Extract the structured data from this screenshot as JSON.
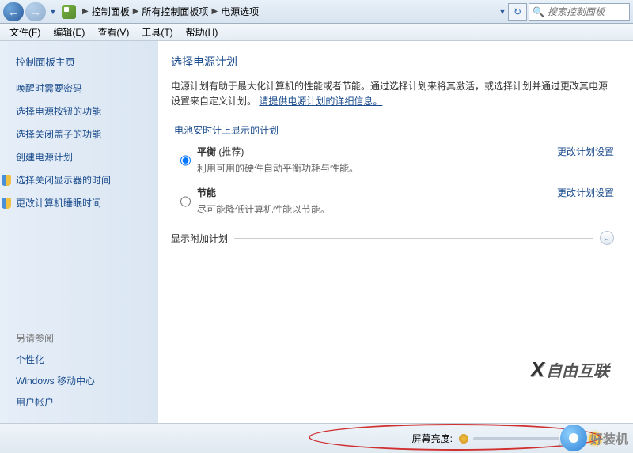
{
  "breadcrumb": {
    "root": "控制面板",
    "mid": "所有控制面板项",
    "leaf": "电源选项"
  },
  "search": {
    "placeholder": "搜索控制面板"
  },
  "menu": {
    "file": "文件(F)",
    "edit": "编辑(E)",
    "view": "查看(V)",
    "tools": "工具(T)",
    "help": "帮助(H)"
  },
  "sidebar": {
    "home": "控制面板主页",
    "links": [
      "唤醒时需要密码",
      "选择电源按钮的功能",
      "选择关闭盖子的功能",
      "创建电源计划",
      "选择关闭显示器的时间",
      "更改计算机睡眠时间"
    ],
    "see_also_title": "另请参阅",
    "see_also": [
      "个性化",
      "Windows 移动中心",
      "用户帐户"
    ]
  },
  "content": {
    "title": "选择电源计划",
    "desc_prefix": "电源计划有助于最大化计算机的性能或者节能。通过选择计划来将其激活，或选择计划并通过更改其电源设置来自定义计划。",
    "desc_link": "请提供电源计划的详细信息。",
    "section_header": "电池安时计上显示的计划",
    "plans": [
      {
        "name": "平衡",
        "rec": "(推荐)",
        "desc": "利用可用的硬件自动平衡功耗与性能。",
        "link": "更改计划设置",
        "selected": true
      },
      {
        "name": "节能",
        "rec": "",
        "desc": "尽可能降低计算机性能以节能。",
        "link": "更改计划设置",
        "selected": false
      }
    ],
    "expander": "显示附加计划"
  },
  "footer": {
    "brightness_label": "屏幕亮度:"
  },
  "watermarks": {
    "wm1": "自由互联",
    "wm2": "好装机"
  }
}
